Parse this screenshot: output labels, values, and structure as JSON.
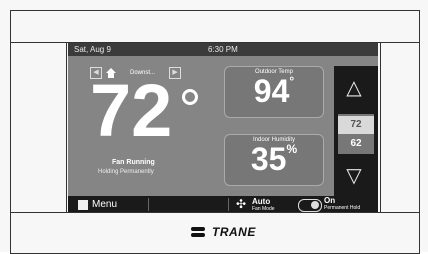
{
  "status_bar": {
    "date": "Sat, Aug 9",
    "time": "6:30 PM"
  },
  "nav": {
    "left": "◀",
    "right": "▶",
    "location_label": "Downst..."
  },
  "main": {
    "setpoint": "72",
    "status_line1": "Fan Running",
    "status_line2": "Holding Permanently"
  },
  "cards": {
    "outdoor_title": "Outdoor Temp",
    "outdoor_value": "94",
    "indoor_title": "Indoor Humidity",
    "indoor_value": "35",
    "percent": "%"
  },
  "right_control": {
    "upper": "72",
    "lower": "62",
    "up_icon": "arrow-up-icon",
    "down_icon": "arrow-down-icon"
  },
  "bottom_bar": {
    "menu_label": "Menu",
    "fan_label": "Auto",
    "fan_sub": "Fan Mode",
    "hold_label": "On",
    "hold_sub": "Permanent Hold"
  },
  "brand": {
    "name": "TRANE"
  }
}
